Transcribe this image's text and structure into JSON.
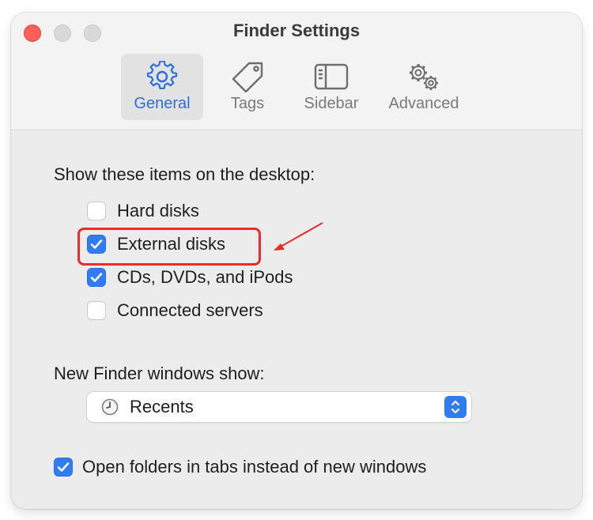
{
  "window": {
    "title": "Finder Settings"
  },
  "tabs": [
    {
      "label": "General",
      "icon": "gear-icon",
      "selected": true
    },
    {
      "label": "Tags",
      "icon": "tag-icon",
      "selected": false
    },
    {
      "label": "Sidebar",
      "icon": "sidebar-icon",
      "selected": false
    },
    {
      "label": "Advanced",
      "icon": "gears-icon",
      "selected": false
    }
  ],
  "desktop_section": {
    "label": "Show these items on the desktop:",
    "items": [
      {
        "label": "Hard disks",
        "checked": false
      },
      {
        "label": "External disks",
        "checked": true,
        "highlighted": true
      },
      {
        "label": "CDs, DVDs, and iPods",
        "checked": true
      },
      {
        "label": "Connected servers",
        "checked": false
      }
    ]
  },
  "new_windows": {
    "label": "New Finder windows show:",
    "selected": "Recents",
    "icon": "clock-icon"
  },
  "open_in_tabs": {
    "label": "Open folders in tabs instead of new windows",
    "checked": true
  },
  "colors": {
    "accent": "#2f7cf6",
    "selected_tab_text": "#2a6fdb",
    "highlight": "#ee2b2b",
    "close_button": "#fe5f57"
  }
}
